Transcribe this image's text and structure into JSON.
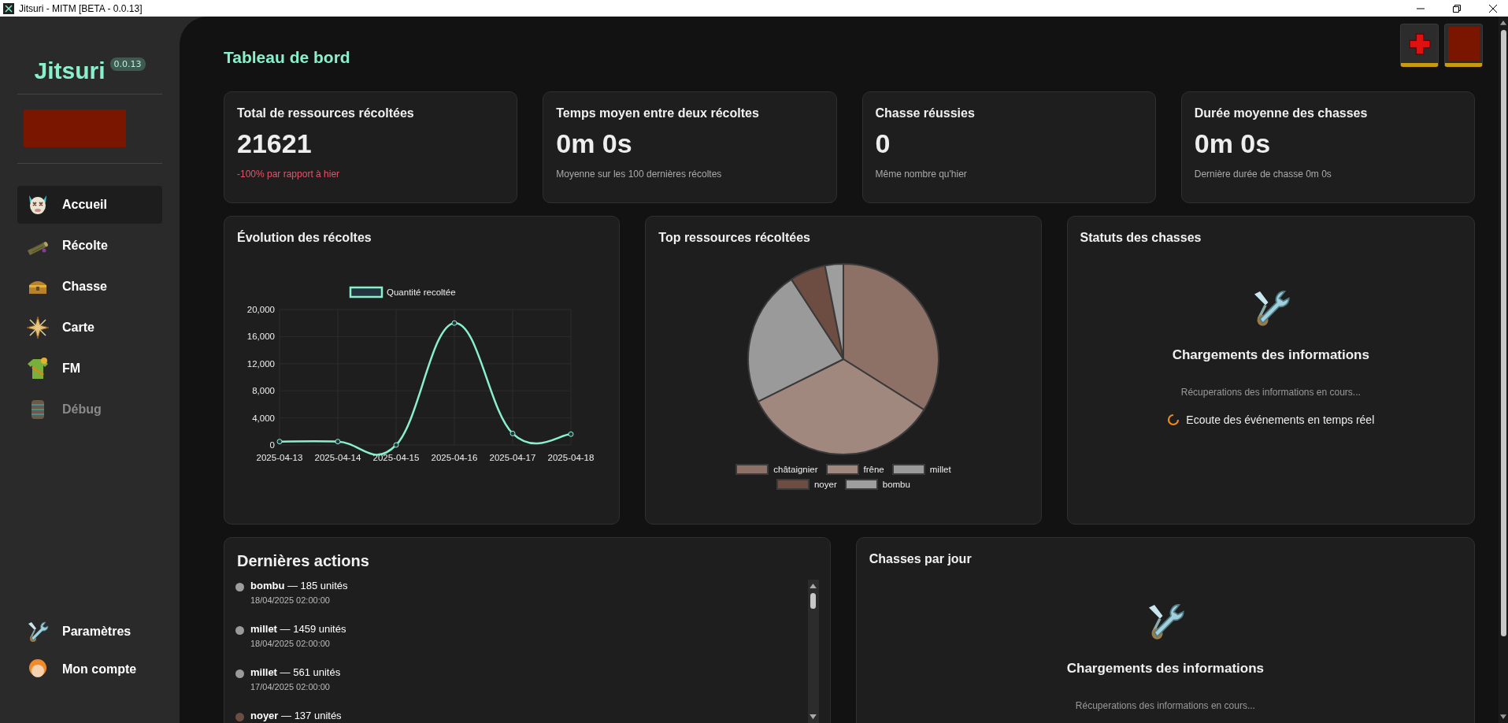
{
  "window": {
    "title": "Jitsuri - MITM [BETA - 0.0.13]"
  },
  "sidebar": {
    "logo": "Jitsuri",
    "version": "0.0.13",
    "items": [
      {
        "label": "Accueil",
        "selected": true,
        "disabled": false
      },
      {
        "label": "Récolte",
        "selected": false,
        "disabled": false
      },
      {
        "label": "Chasse",
        "selected": false,
        "disabled": false
      },
      {
        "label": "Carte",
        "selected": false,
        "disabled": false
      },
      {
        "label": "FM",
        "selected": false,
        "disabled": false
      },
      {
        "label": "Débug",
        "selected": false,
        "disabled": true
      }
    ],
    "footer_items": [
      {
        "label": "Paramètres"
      },
      {
        "label": "Mon compte"
      }
    ]
  },
  "header": {
    "title": "Tableau de bord"
  },
  "stats": [
    {
      "title": "Total de ressources récoltées",
      "value": "21621",
      "note": "-100% par rapport à hier",
      "kind": "negative"
    },
    {
      "title": "Temps moyen entre deux récoltes",
      "value": "0m 0s",
      "note": "Moyenne sur les 100 dernières récoltes",
      "kind": "neutral"
    },
    {
      "title": "Chasse réussies",
      "value": "0",
      "note": "Même nombre qu'hier",
      "kind": "neutral"
    },
    {
      "title": "Durée moyenne des chasses",
      "value": "0m 0s",
      "note": "Dernière durée de chasse 0m 0s",
      "kind": "neutral"
    }
  ],
  "harvest_evolution": {
    "title": "Évolution des récoltes",
    "chart_data": {
      "type": "line",
      "categories": [
        "2025-04-13",
        "2025-04-14",
        "2025-04-15",
        "2025-04-16",
        "2025-04-17",
        "2025-04-18"
      ],
      "series": [
        {
          "name": "Quantité recoltée",
          "color": "#8af0cc",
          "marker": "circle",
          "values": [
            500,
            500,
            0,
            18000,
            1700,
            1600
          ]
        }
      ],
      "grid": true,
      "legend": "top",
      "ylim": [
        0,
        20000
      ],
      "yticks": [
        {
          "value": 0,
          "label": "0"
        },
        {
          "value": 4000,
          "label": "4,000"
        },
        {
          "value": 8000,
          "label": "8,000"
        },
        {
          "value": 12000,
          "label": "12,000"
        },
        {
          "value": 16000,
          "label": "16,000"
        },
        {
          "value": 20000,
          "label": "20,000"
        }
      ]
    }
  },
  "top_resources": {
    "title": "Top ressources récoltées",
    "chart_data": {
      "type": "pie",
      "categories": [
        "châtaignier",
        "frêne",
        "millet",
        "noyer",
        "bombu"
      ],
      "legend": "bottom",
      "series": [
        {
          "values": [
            34,
            33.8,
            23.2,
            6.1,
            3.1
          ]
        }
      ],
      "colors": [
        "#8d7066",
        "#a1887e",
        "#9a9a9a",
        "#6d4c41",
        "#9e9e9e"
      ]
    }
  },
  "hunt_status": {
    "title": "Statuts des chasses",
    "loading_title": "Chargements des informations",
    "loading_text": "Récuperations des informations en cours...",
    "live_text": "Ecoute des événements en temps réel"
  },
  "recent_actions": {
    "title": "Dernières actions",
    "items": [
      {
        "text": "**bombu** — 185 unités",
        "date": "18/04/2025 02:00:00",
        "color": "#9e9e9e"
      },
      {
        "text": "**millet** — 1459 unités",
        "date": "18/04/2025 02:00:00",
        "color": "#9a9a9a"
      },
      {
        "text": "**millet** — 561 unités",
        "date": "17/04/2025 02:00:00",
        "color": "#9a9a9a"
      },
      {
        "text": "**noyer** — 137 unités",
        "color": "#6d4c41"
      }
    ]
  },
  "hunts_per_day": {
    "title": "Chasses par jour",
    "loading_title": "Chargements des informations",
    "loading_text": "Récuperations des informations en cours..."
  }
}
